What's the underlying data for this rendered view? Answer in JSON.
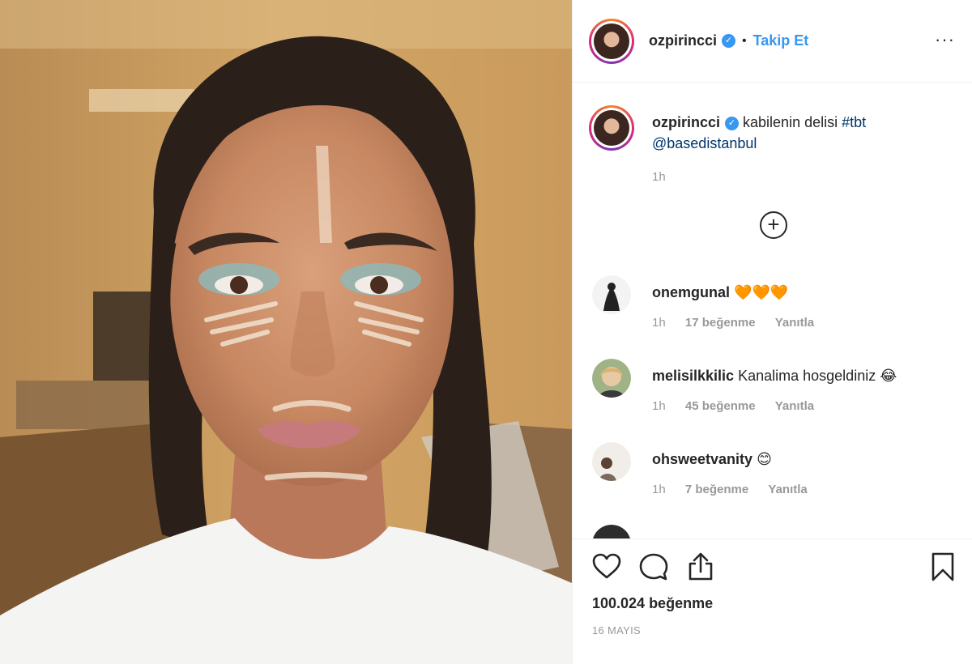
{
  "header": {
    "username": "ozpirincci",
    "verified": true,
    "separator": "•",
    "follow_label": "Takip Et",
    "more_icon": "···"
  },
  "caption": {
    "username": "ozpirincci",
    "text": "kabilenin delisi",
    "hashtag": "#tbt",
    "mention": "@basedistanbul",
    "time": "1h"
  },
  "load_more_icon": "+",
  "comments": [
    {
      "username": "onemgunal",
      "text": "",
      "emoji": "🧡🧡🧡",
      "time": "1h",
      "likes": "17 beğenme",
      "reply": "Yanıtla"
    },
    {
      "username": "melisilkkilic",
      "text": "Kanalima hosgeldiniz",
      "emoji": "😂",
      "time": "1h",
      "likes": "45 beğenme",
      "reply": "Yanıtla"
    },
    {
      "username": "ohsweetvanity",
      "text": "",
      "emoji": "😊",
      "time": "1h",
      "likes": "7 beğenme",
      "reply": "Yanıtla"
    }
  ],
  "actions": {
    "likes_count": "100.024 beğenme",
    "date": "16 MAYIS"
  },
  "colors": {
    "accent": "#3897f0",
    "link": "#003569",
    "muted": "#999999",
    "border": "#efefef"
  }
}
